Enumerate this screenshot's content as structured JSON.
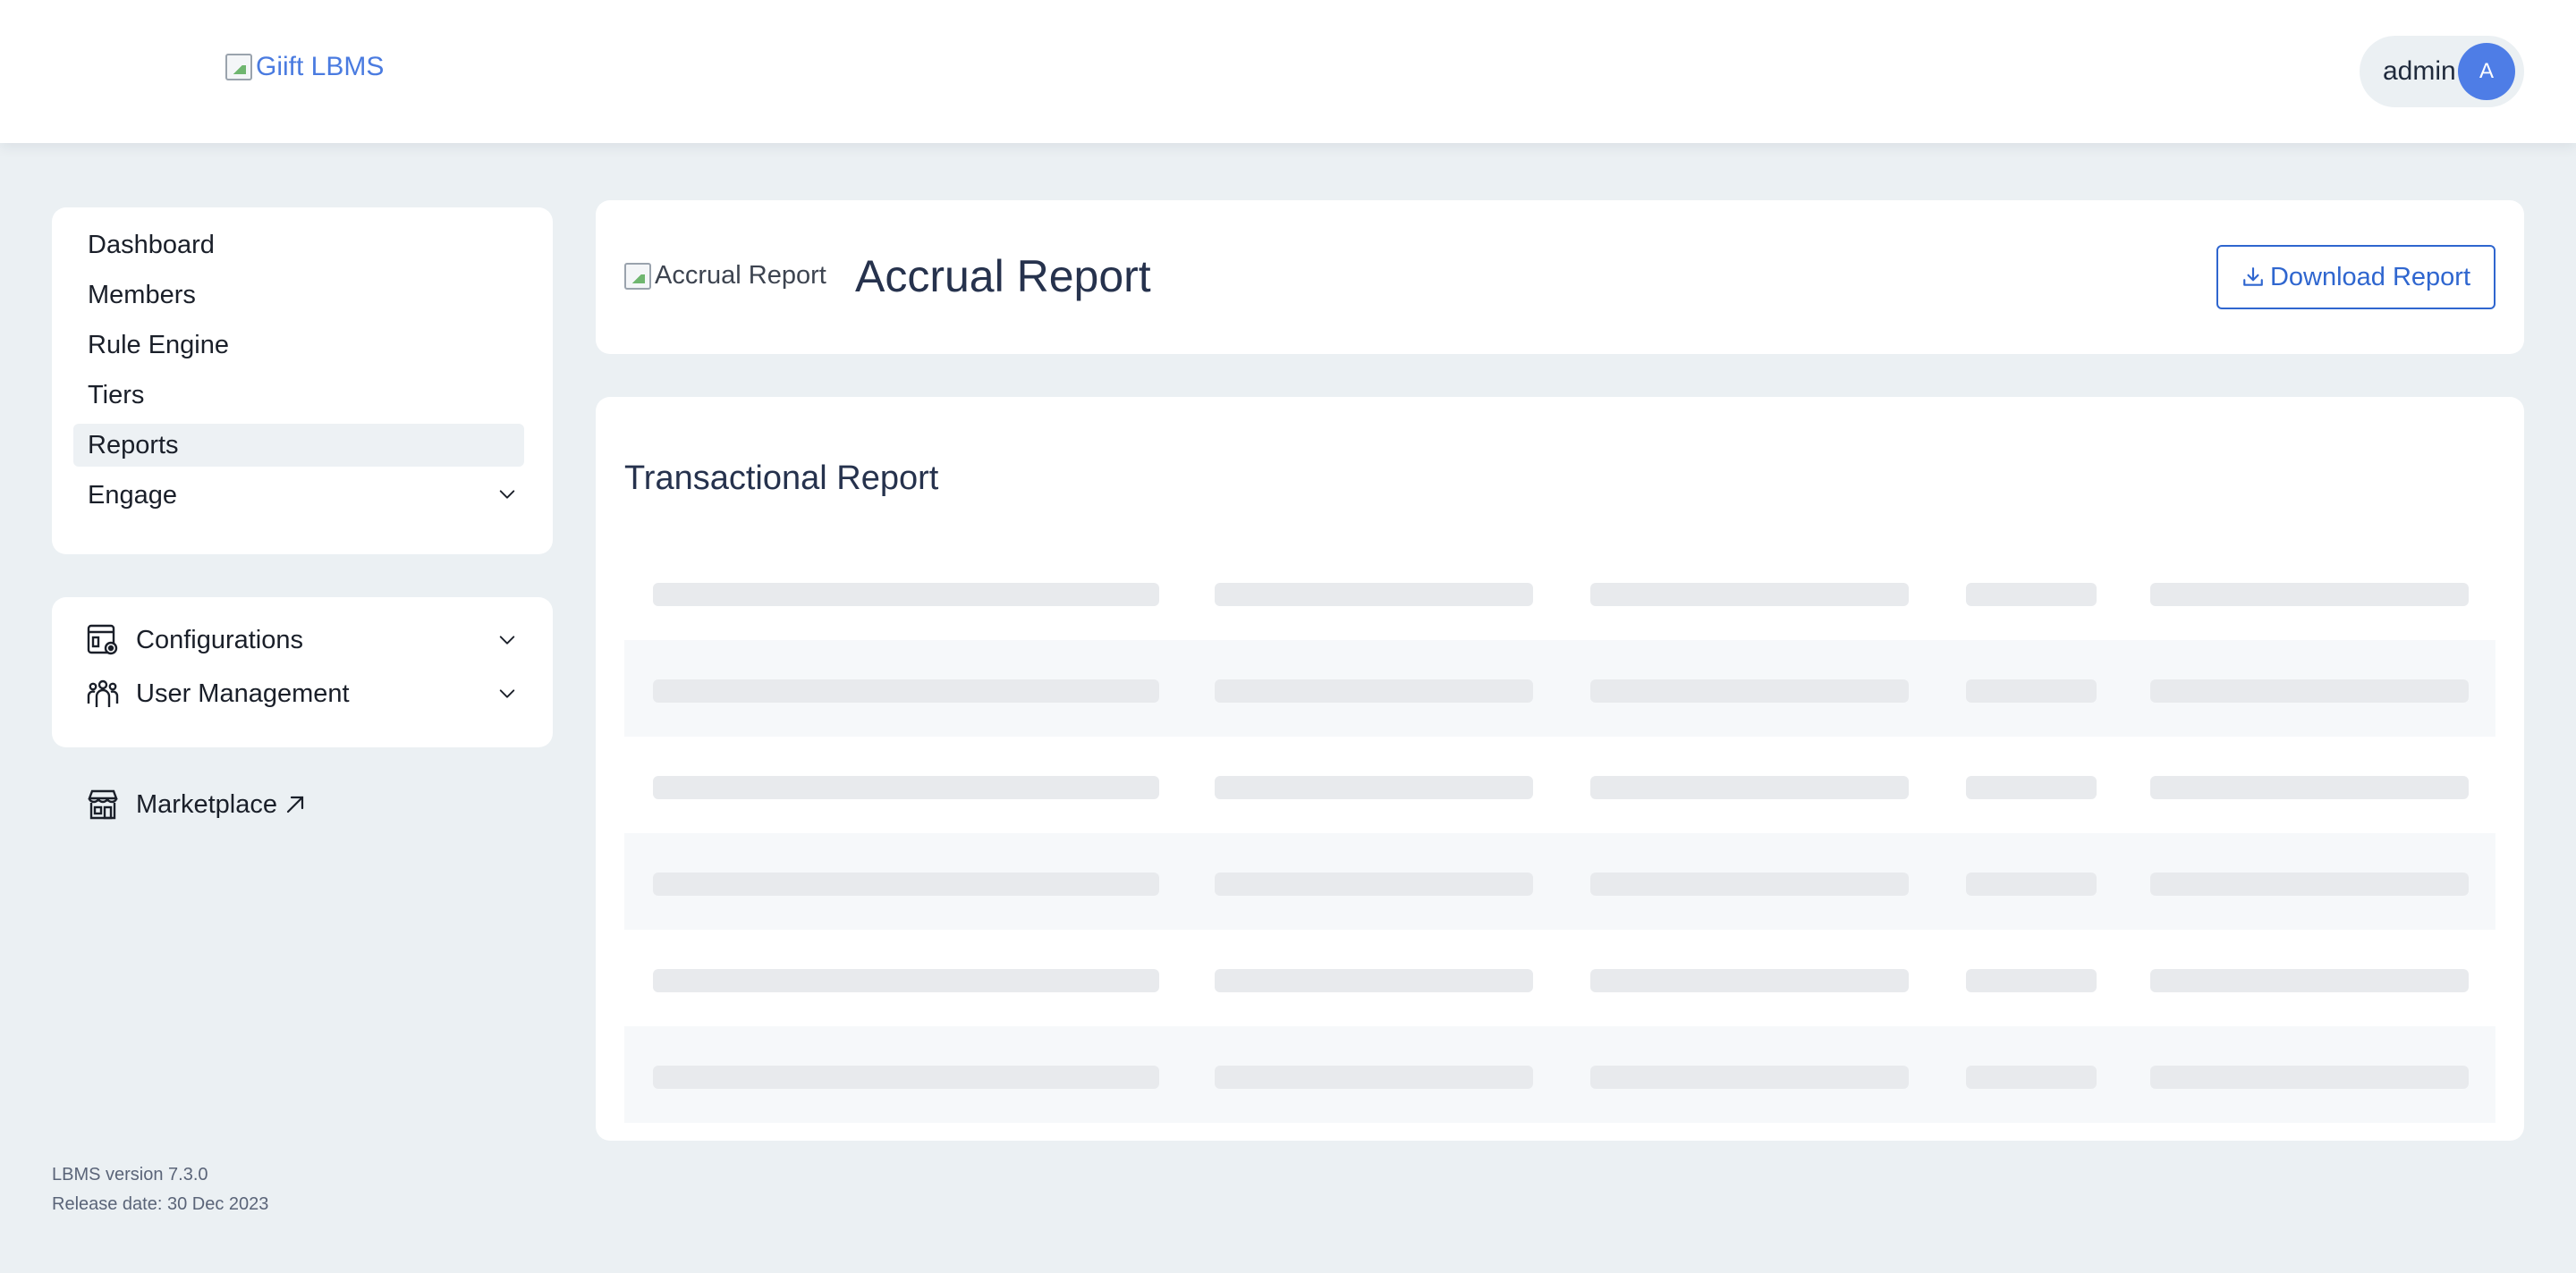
{
  "header": {
    "logo_alt": "Giift LBMS",
    "user": {
      "name": "admin",
      "avatar_initial": "A"
    }
  },
  "sidebar": {
    "nav": [
      {
        "label": "Dashboard",
        "active": false
      },
      {
        "label": "Members",
        "active": false
      },
      {
        "label": "Rule Engine",
        "active": false
      },
      {
        "label": "Tiers",
        "active": false
      },
      {
        "label": "Reports",
        "active": true
      },
      {
        "label": "Engage",
        "active": false,
        "expandable": true
      }
    ],
    "config_items": [
      {
        "label": "Configurations",
        "icon": "configurations-icon"
      },
      {
        "label": "User Management",
        "icon": "user-management-icon"
      }
    ],
    "marketplace": {
      "label": "Marketplace",
      "icon": "marketplace-icon",
      "external": true
    }
  },
  "footer": {
    "version": "LBMS version 7.3.0",
    "release": "Release date: 30 Dec 2023"
  },
  "page": {
    "image_alt": "Accrual Report",
    "title": "Accrual Report",
    "download_label": "Download Report"
  },
  "report": {
    "section_title": "Transactional Report",
    "loading_rows": 6,
    "loading_columns": 5
  },
  "colors": {
    "accent": "#2f66cf",
    "avatar": "#4e7de6",
    "background": "#ebf0f3",
    "skeleton": "#e8eaed"
  }
}
